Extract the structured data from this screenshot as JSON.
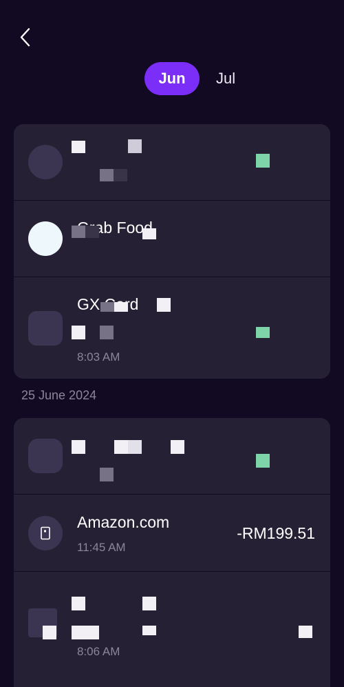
{
  "header": {
    "back_icon": "chevron-left-icon",
    "tabs": [
      {
        "label": "Jun",
        "active": true
      },
      {
        "label": "Jul",
        "active": false
      }
    ]
  },
  "group1": {
    "transactions": [
      {
        "name": "",
        "time": "",
        "amount": ""
      },
      {
        "name": "Grab Food",
        "time": "",
        "amount": ""
      },
      {
        "name": "GX Card",
        "time": "8:03 AM",
        "amount": ""
      }
    ]
  },
  "group2": {
    "date": "25 June 2024",
    "transactions": [
      {
        "name": "",
        "time": "",
        "amount": ""
      },
      {
        "name": "Amazon.com",
        "time": "11:45 AM",
        "amount": "-RM199.51",
        "icon": "card-icon"
      },
      {
        "name": "",
        "time": "8:06 AM",
        "amount": ""
      }
    ]
  },
  "colors": {
    "background": "#120a22",
    "card": "#262035",
    "accent": "#7a2ef7",
    "credit": "#6fd3a0",
    "muted_text": "#8c869a"
  }
}
